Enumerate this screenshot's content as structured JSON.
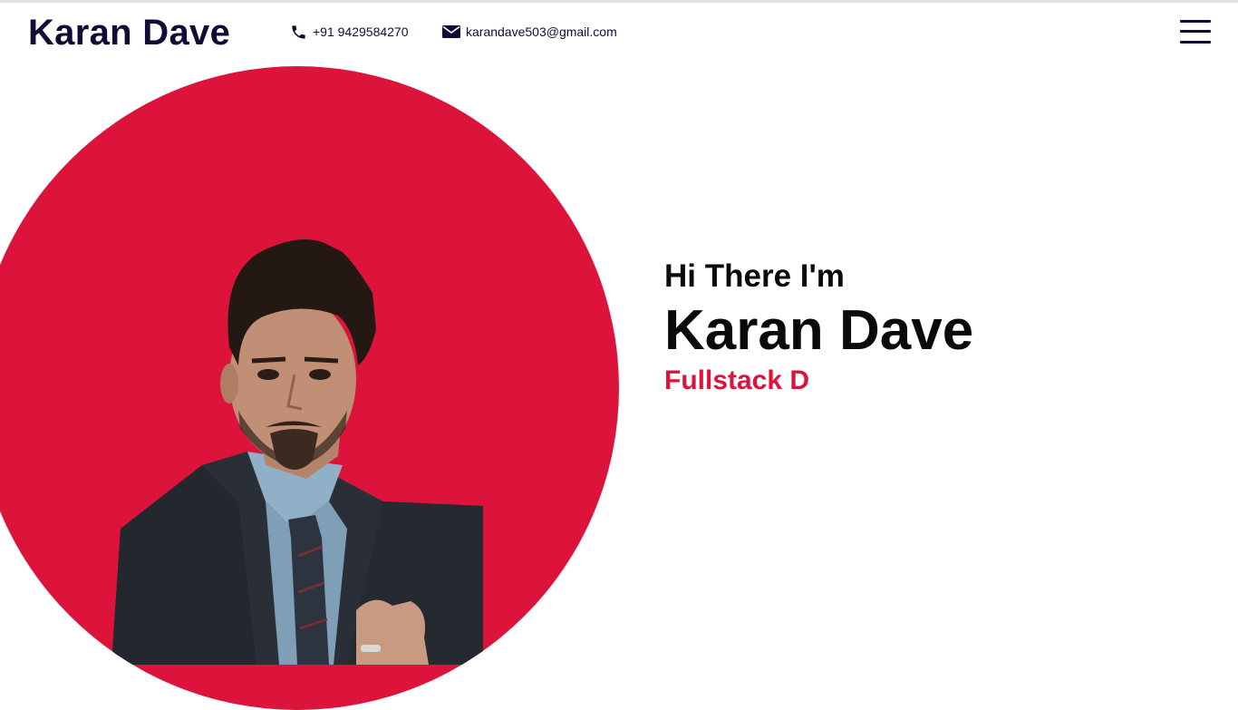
{
  "navbar": {
    "brand": "Karan Dave",
    "phone": "+91 9429584270",
    "email": "karandave503@gmail.com",
    "phone_icon": "phone-icon",
    "email_icon": "envelope-icon",
    "menu_icon": "hamburger-menu-icon"
  },
  "hero": {
    "greeting": "Hi There I'm",
    "name": "Karan Dave",
    "typed_role": "Fullstack D",
    "portrait_icon": "profile-portrait",
    "accent_color": "#dc143c",
    "brand_color": "#150a35"
  }
}
